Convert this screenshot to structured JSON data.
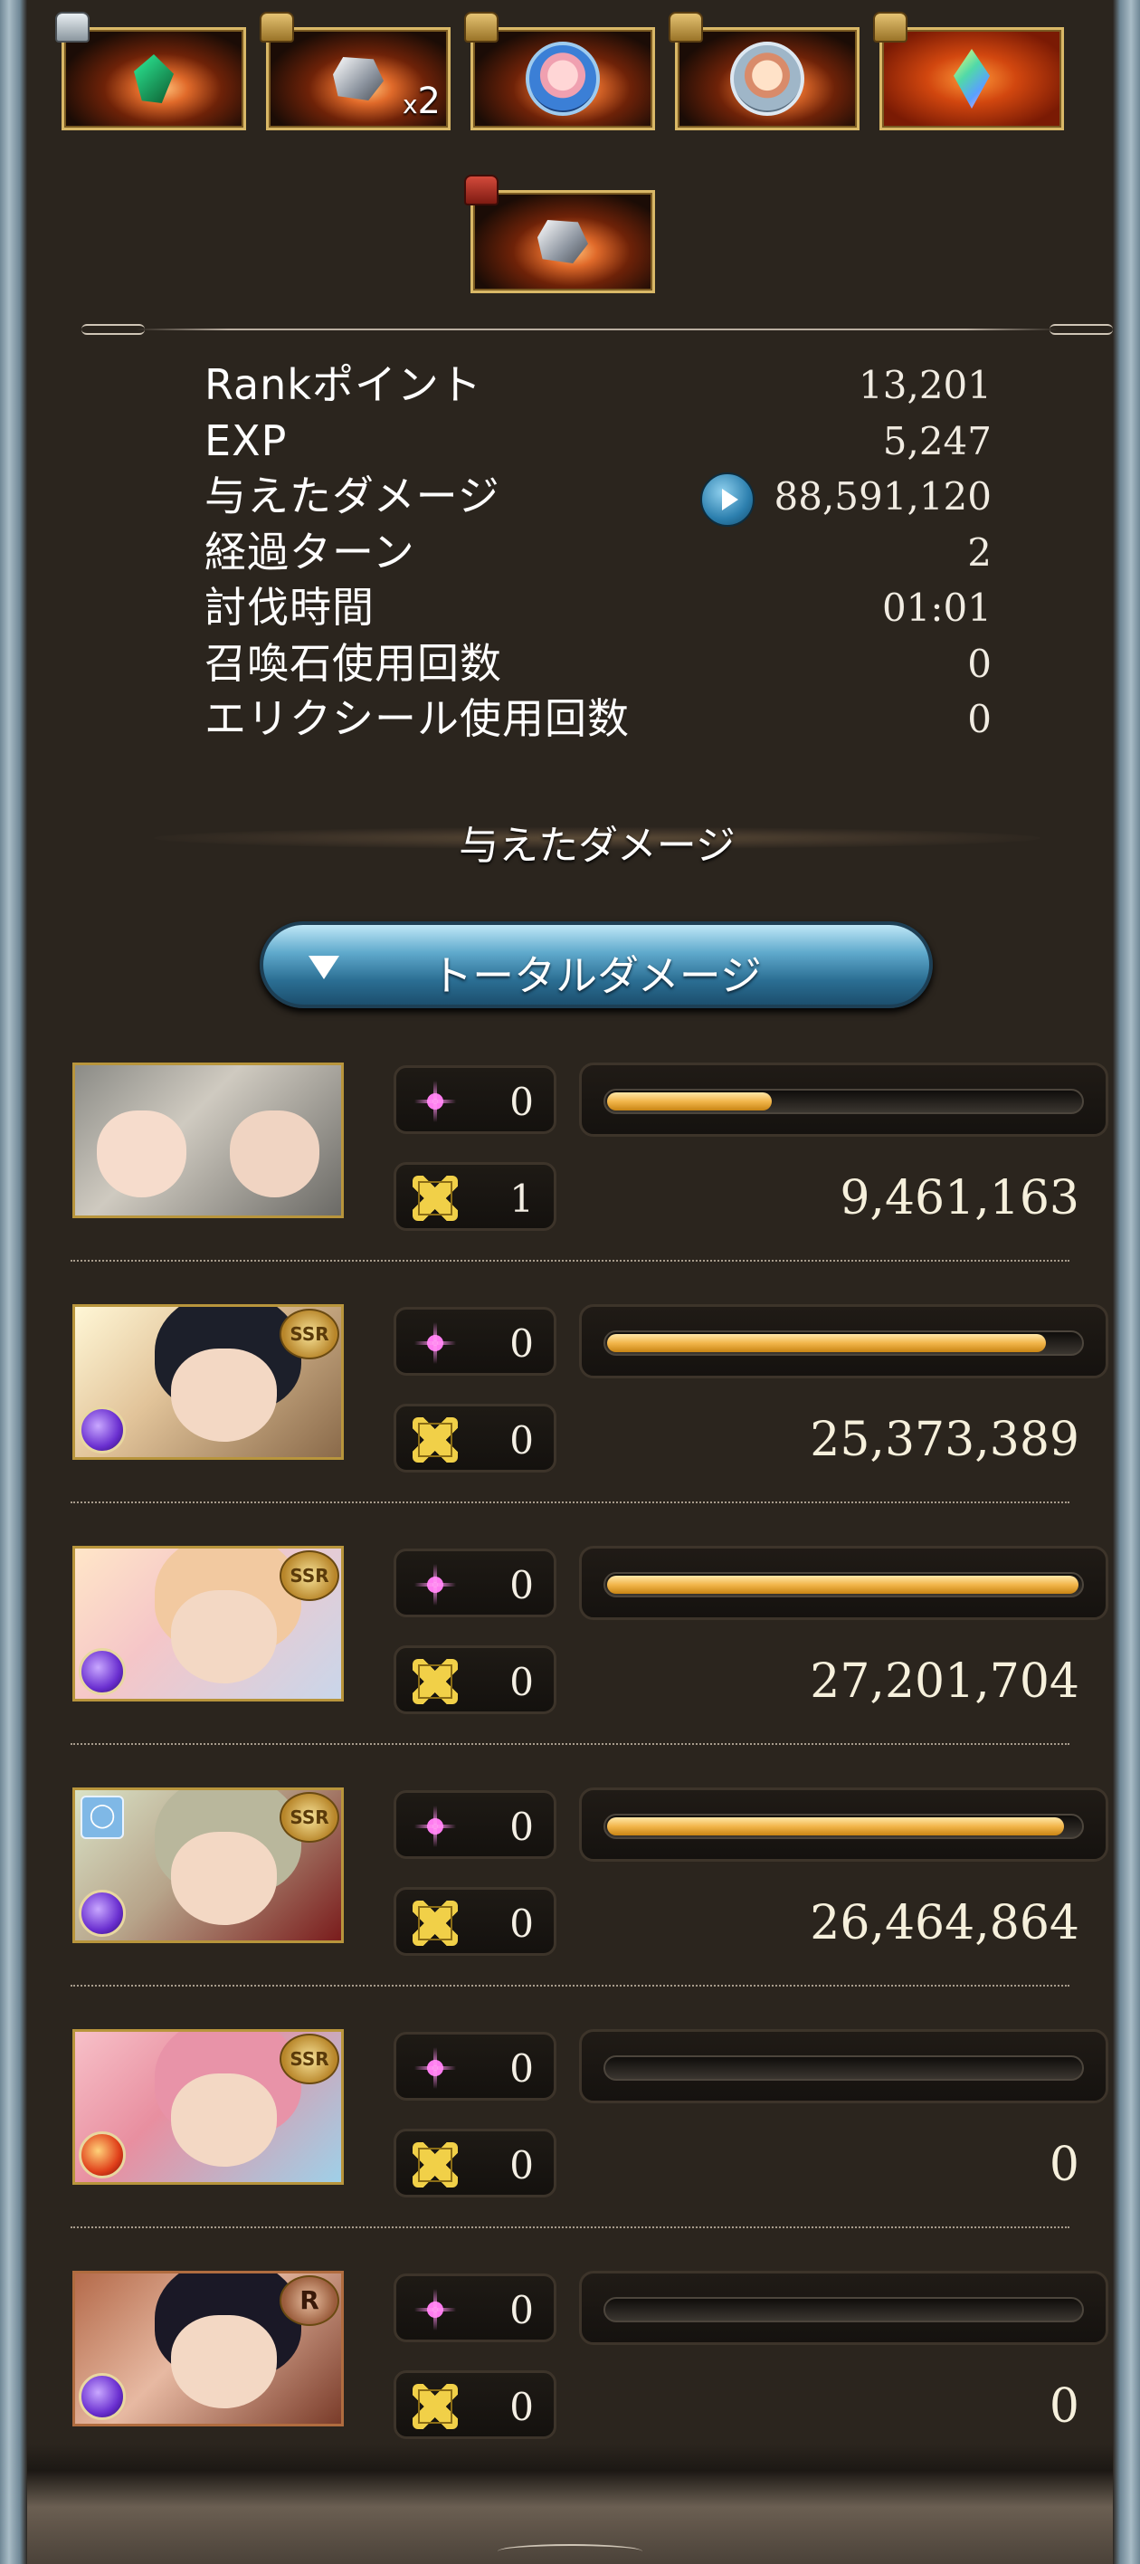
{
  "rewards": {
    "row1": [
      {
        "chest": "silver",
        "item": "green-gem",
        "qty": ""
      },
      {
        "chest": "gold",
        "item": "silver-ore",
        "qty": "2"
      },
      {
        "chest": "gold",
        "item": "character-orb",
        "qty": ""
      },
      {
        "chest": "gold",
        "item": "character-orb",
        "qty": ""
      },
      {
        "chest": "gold",
        "item": "rainbow-crystal",
        "qty": ""
      }
    ],
    "row2": [
      {
        "chest": "red",
        "item": "silver-ore",
        "qty": ""
      }
    ],
    "qty_prefix": "x"
  },
  "stats": [
    {
      "label": "Rankポイント",
      "value": "13,201"
    },
    {
      "label": "EXP",
      "value": "5,247"
    },
    {
      "label": "与えたダメージ",
      "value": "88,591,120"
    },
    {
      "label": "経過ターン",
      "value": "2"
    },
    {
      "label": "討伐時間",
      "value": "01:01"
    },
    {
      "label": "召喚石使用回数",
      "value": "0"
    },
    {
      "label": "エリクシール使用回数",
      "value": "0"
    }
  ],
  "damage_section": {
    "title": "与えたダメージ",
    "dropdown_label": "トータルダメージ"
  },
  "characters": [
    {
      "portrait": "wolf-hood-duo",
      "rarity": "",
      "element": "",
      "ougi": "0",
      "cross": "1",
      "damage": "9,461,163",
      "bar_fraction": 0.35
    },
    {
      "portrait": "dark-haired-swordsman",
      "rarity": "SSR",
      "element": "dark",
      "ougi": "0",
      "cross": "0",
      "damage": "25,373,389",
      "bar_fraction": 0.93
    },
    {
      "portrait": "two-girls",
      "rarity": "SSR",
      "element": "dark",
      "ougi": "0",
      "cross": "0",
      "damage": "27,201,704",
      "bar_fraction": 1.0
    },
    {
      "portrait": "grey-haired-warrior",
      "rarity": "SSR",
      "element": "dark",
      "ring": "ring-icon",
      "ougi": "0",
      "cross": "0",
      "damage": "26,464,864",
      "bar_fraction": 0.97
    },
    {
      "portrait": "pink-haired-girl",
      "rarity": "SSR",
      "element": "fire",
      "ougi": "0",
      "cross": "0",
      "damage": "0",
      "bar_fraction": 0
    },
    {
      "portrait": "black-haired-girl",
      "rarity": "R",
      "element": "dark",
      "ougi": "0",
      "cross": "0",
      "damage": "0",
      "bar_fraction": 0
    }
  ],
  "colors": {
    "panel_bg": "#2b251e",
    "bar_fill": "#f2b64b",
    "dropdown": "#2b6e93",
    "item_border": "#d9b867"
  }
}
